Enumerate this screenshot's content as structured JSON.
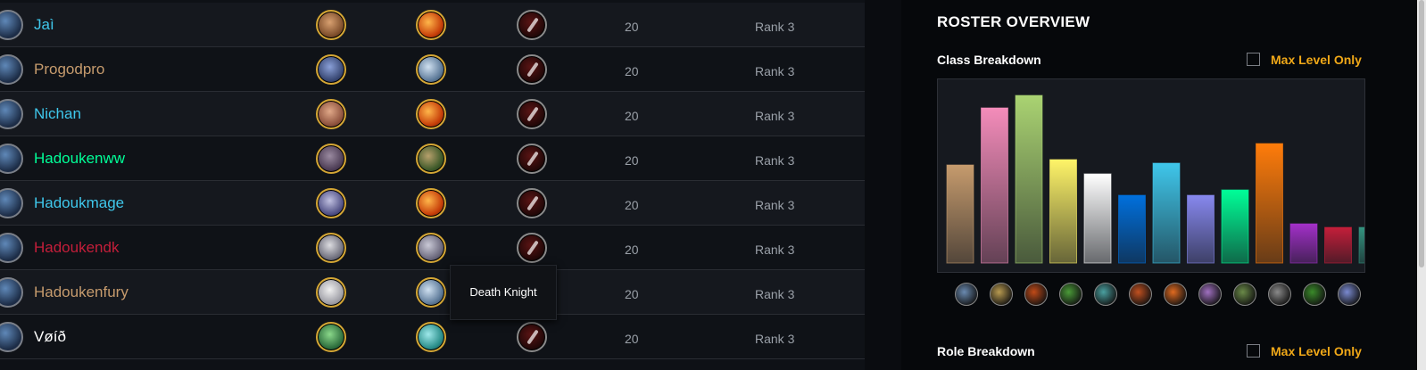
{
  "roster": [
    {
      "name": "Jaì",
      "name_color": "#3fc7eb",
      "level": "20",
      "rank": "Rank 3",
      "race_icon": "human-male-icon",
      "class_icon": "mage-icon"
    },
    {
      "name": "Progodpro",
      "name_color": "#c69b6d",
      "level": "20",
      "rank": "Rank 3",
      "race_icon": "draenei-male-icon",
      "class_icon": "warrior-icon"
    },
    {
      "name": "Nichan",
      "name_color": "#3fc7eb",
      "level": "20",
      "rank": "Rank 3",
      "race_icon": "human-female-icon",
      "class_icon": "mage-icon"
    },
    {
      "name": "Hadoukenww",
      "name_color": "#00ff98",
      "level": "20",
      "rank": "Rank 3",
      "race_icon": "orc-male-icon",
      "class_icon": "monk-icon"
    },
    {
      "name": "Hadoukmage",
      "name_color": "#3fc7eb",
      "level": "20",
      "rank": "Rank 3",
      "race_icon": "night-elf-male-icon",
      "class_icon": "mage-icon"
    },
    {
      "name": "Hadoukendk",
      "name_color": "#c41e3a",
      "level": "20",
      "rank": "Rank 3",
      "race_icon": "undead-male-icon",
      "class_icon": "death-knight-icon"
    },
    {
      "name": "Hadoukenfury",
      "name_color": "#c69b6d",
      "level": "20",
      "rank": "Rank 3",
      "race_icon": "blood-elf-male-icon",
      "class_icon": "warrior-icon"
    },
    {
      "name": "Vøíð",
      "name_color": "#ffffff",
      "level": "20",
      "rank": "Rank 3",
      "race_icon": "night-elf-female-icon",
      "class_icon": "evoker-icon"
    }
  ],
  "tooltip": {
    "text": "Death Knight"
  },
  "panel": {
    "title": "ROSTER OVERVIEW",
    "class_breakdown_label": "Class Breakdown",
    "role_breakdown_label": "Role Breakdown",
    "max_level_only_label": "Max Level Only",
    "max_level_only_checked": false,
    "accent_color": "#f0a818"
  },
  "chart_data": {
    "type": "bar",
    "title": "Class Breakdown",
    "categories": [
      "Warrior",
      "Paladin",
      "Hunter",
      "Rogue",
      "Priest",
      "Shaman",
      "Mage",
      "Warlock",
      "Monk",
      "Druid",
      "Demon Hunter",
      "Death Knight",
      "Evoker"
    ],
    "values": [
      55,
      87,
      94,
      58,
      50,
      38,
      56,
      38,
      41,
      67,
      22,
      20,
      20
    ],
    "colors": [
      "#c69b6d",
      "#f48cba",
      "#aad372",
      "#fff468",
      "#ffffff",
      "#0070dd",
      "#3fc7eb",
      "#8788ee",
      "#00ff98",
      "#ff7c0a",
      "#a330c9",
      "#c41e3a",
      "#33937f"
    ],
    "ylim": [
      0,
      100
    ],
    "grid": false,
    "class_icons": [
      "warrior-icon",
      "paladin-icon",
      "hunter-icon",
      "rogue-icon",
      "priest-icon",
      "shaman-icon",
      "mage-icon",
      "warlock-icon",
      "druid-icon",
      "monk-icon",
      "death-knight-icon",
      "demon-hunter-icon",
      "evoker-icon",
      "evoker-alt-icon"
    ]
  }
}
